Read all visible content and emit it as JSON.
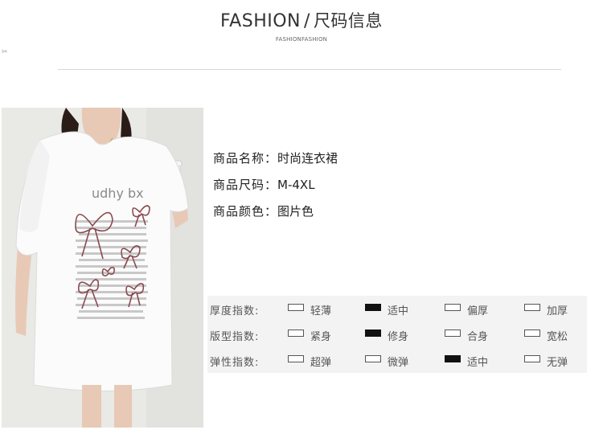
{
  "header": {
    "title_en": "FASHION",
    "separator": "/",
    "title_cn": "尺码信息",
    "subtitle": "FASHIONFASHION"
  },
  "side_mark_icon": "scissors-icon",
  "product": {
    "name_label": "商品名称：",
    "name_value": "时尚连衣裙",
    "size_label": "商品尺码：",
    "size_value": "M-4XL",
    "color_label": "商品颜色：",
    "color_value": "图片色"
  },
  "photo": {
    "shirt_text": "udhy bx",
    "motif": "bow-print"
  },
  "indices": {
    "rows": [
      {
        "label": "厚度指数:",
        "options": [
          {
            "text": "轻薄",
            "selected": false
          },
          {
            "text": "适中",
            "selected": true
          },
          {
            "text": "偏厚",
            "selected": false
          },
          {
            "text": "加厚",
            "selected": false
          }
        ]
      },
      {
        "label": "版型指数:",
        "options": [
          {
            "text": "紧身",
            "selected": false
          },
          {
            "text": "修身",
            "selected": true
          },
          {
            "text": "合身",
            "selected": false
          },
          {
            "text": "宽松",
            "selected": false
          }
        ]
      },
      {
        "label": "弹性指数:",
        "options": [
          {
            "text": "超弹",
            "selected": false
          },
          {
            "text": "微弹",
            "selected": false
          },
          {
            "text": "适中",
            "selected": true
          },
          {
            "text": "无弹",
            "selected": false
          }
        ]
      }
    ]
  },
  "colors": {
    "selected_box": "#111111",
    "table_bg": "#f3f3f3",
    "divider": "#d8d8d8"
  }
}
